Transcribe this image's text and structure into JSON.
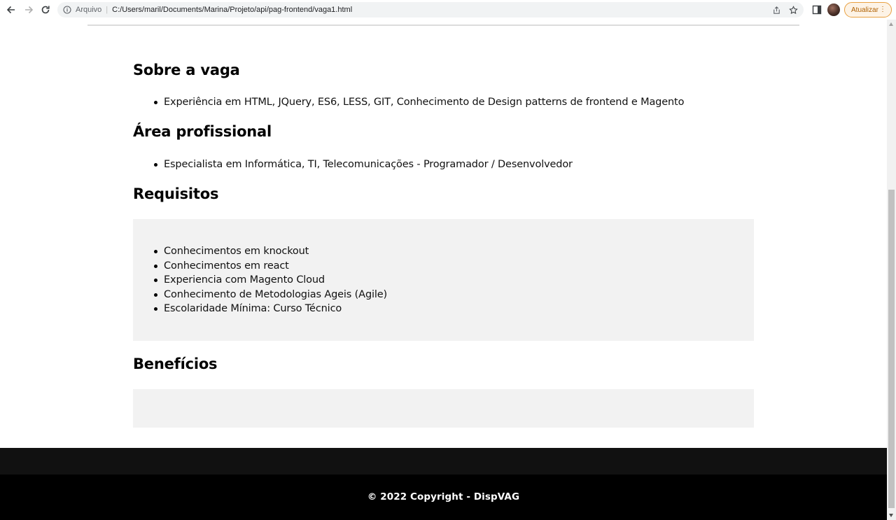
{
  "browser": {
    "url_scheme": "Arquivo",
    "url": "C:/Users/maril/Documents/Marina/Projeto/api/pag-frontend/vaga1.html",
    "update_label": "Atualizar",
    "update_menu": "⋮",
    "accent_color": "#e8a040"
  },
  "sections": {
    "about": {
      "title": "Sobre a vaga",
      "items": [
        "Experiência em HTML, JQuery, ES6, LESS, GIT, Conhecimento de Design patterns de frontend e Magento"
      ]
    },
    "area": {
      "title": "Área profissional",
      "items": [
        "Especialista em Informática, TI, Telecomunicações - Programador / Desenvolvedor"
      ]
    },
    "requirements": {
      "title": "Requisitos",
      "items": [
        "Conhecimentos em knockout",
        "Conhecimentos em react",
        "Experiencia com Magento Cloud",
        "Conhecimento de Metodologias Ageis (Agile)",
        "Escolaridade Mínima: Curso Técnico"
      ]
    },
    "benefits": {
      "title": "Benefícios",
      "items": []
    }
  },
  "footer": {
    "copyright": "© 2022 Copyright - DispVAG"
  }
}
